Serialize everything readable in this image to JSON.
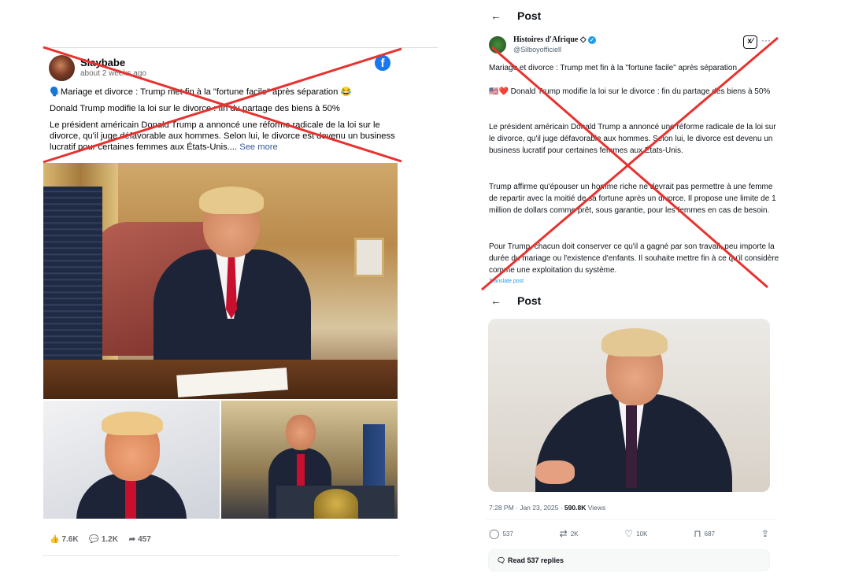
{
  "facebook_post": {
    "author": "Slaybabe",
    "time": "about 2 weeks ago",
    "logo": "f",
    "text_line1": "🗣️Mariage et divorce : Trump met fin à la \"fortune facile\" après séparation 😂",
    "text_line2": "Donald Trump modifie la loi sur le divorce : fin du partage des biens à 50%",
    "text_body": "Le président américain Donald Trump a annoncé une réforme radicale de la loi sur le divorce, qu'il juge défavorable aux hommes. Selon lui, le divorce est devenu un business lucratif pour certaines femmes aux États-Unis....",
    "see_more": "See more",
    "stats": {
      "likes": "7.6K",
      "comments": "1.2K",
      "shares": "457"
    },
    "icons": {
      "like": "thumbs-up-icon",
      "comment": "comment-icon",
      "share": "share-icon"
    }
  },
  "twitter_post": {
    "header_title": "Post",
    "author_name": "Histoires d'Afrique",
    "author_handle": "@Silboyofficiell",
    "grok_label": "x⁄",
    "more": "···",
    "para1": "Mariage et divorce : Trump met fin à la \"fortune facile\" après séparation",
    "para2": "🇺🇸❤️ Donald Trump modifie la loi sur le divorce : fin du partage des biens à 50%",
    "para3": "Le président américain Donald Trump a annoncé une réforme radicale de la loi sur le divorce, qu'il juge défavorable aux hommes. Selon lui, le divorce est devenu un business lucratif pour certaines femmes aux États-Unis.",
    "para4": "Trump affirme qu'épouser un homme riche ne devrait pas permettre à une femme de repartir avec la moitié de sa fortune après un divorce. Il propose une limite de 1 million de dollars comme prêt, sous garantie, pour les femmes en cas de besoin.",
    "para5": "Pour Trump, chacun doit conserver ce qu'il a gagné par son travail, peu importe la durée du mariage ou l'existence d'enfants. Il souhaite mettre fin à ce qu'il considère comme une exploitation du système.",
    "translate": "Translate post"
  },
  "twitter_post2": {
    "header_title": "Post",
    "timestamp": "7:28 PM · Jan 23, 2025 · ",
    "views_count": "590.8K",
    "views_label": " Views",
    "actions": {
      "replies": "537",
      "reposts": "2K",
      "likes": "10K",
      "bookmarks": "687"
    },
    "read_replies": "Read 537 replies"
  },
  "colors": {
    "cross": "#e8322f",
    "fb_blue": "#1877f2",
    "tw_blue": "#1d9bf0"
  }
}
